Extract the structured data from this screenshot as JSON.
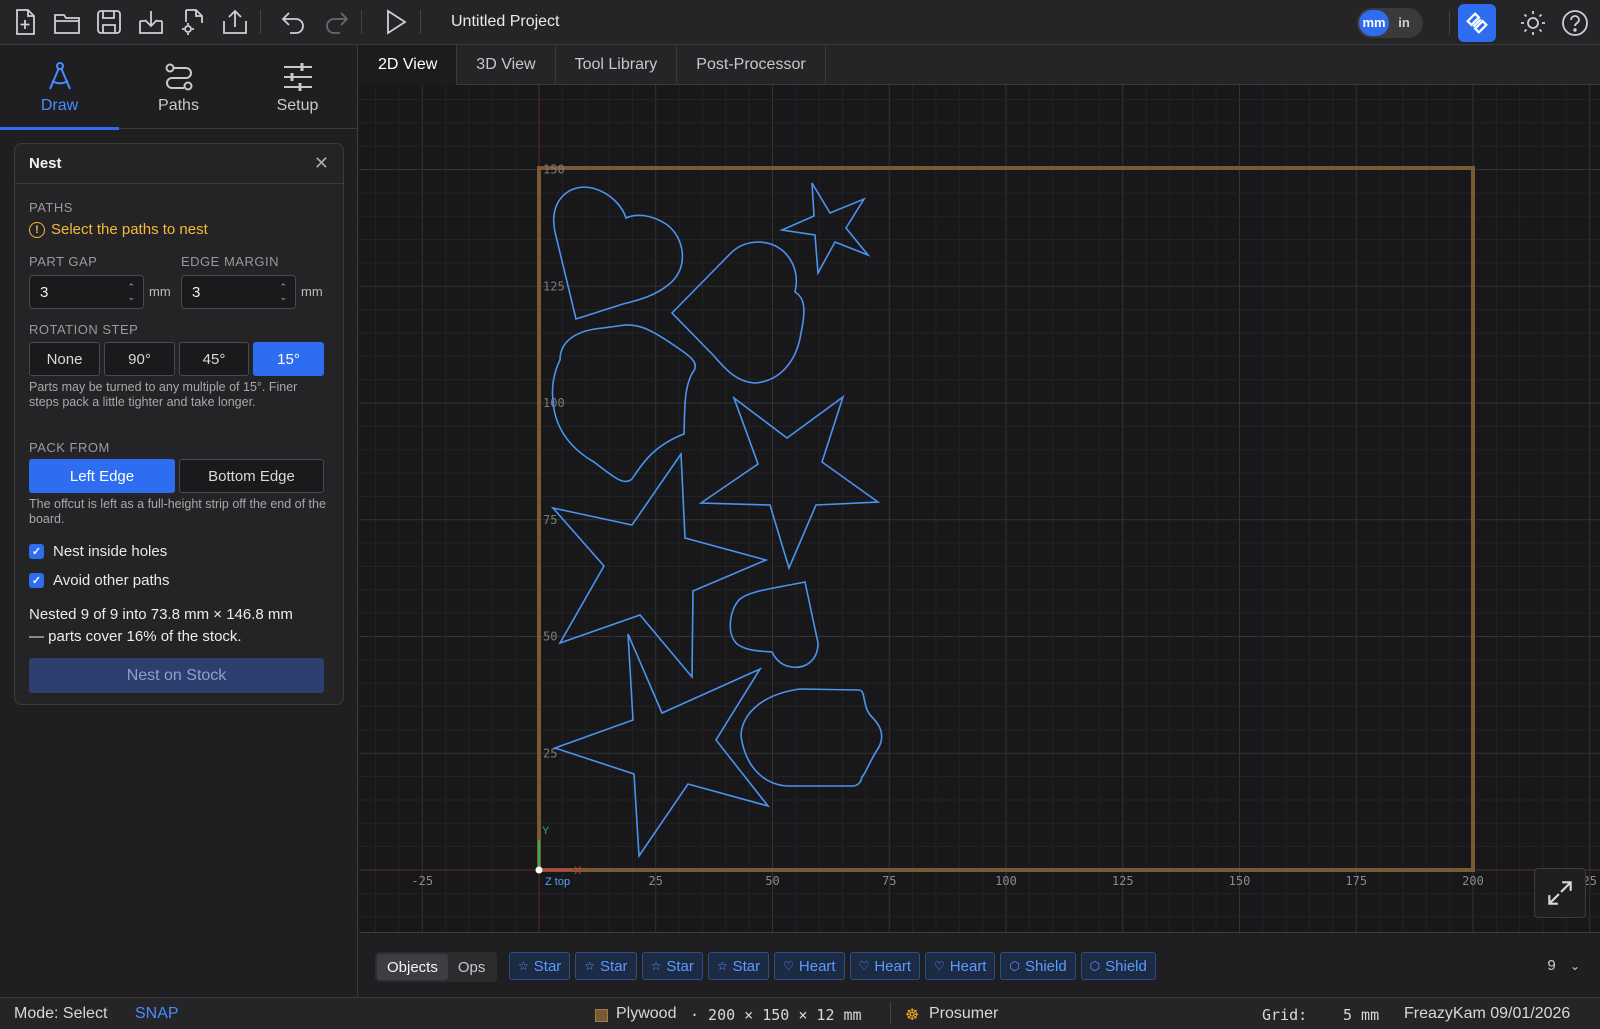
{
  "topbar": {
    "project_title": "Untitled Project",
    "units": {
      "mm": "mm",
      "in": "in",
      "active": "mm"
    },
    "icons": [
      "new-file-icon",
      "open-folder-icon",
      "save-icon",
      "download-icon",
      "file-settings-icon",
      "export-icon",
      "undo-icon",
      "redo-icon",
      "run-icon",
      "logo-icon",
      "theme-icon",
      "help-icon"
    ]
  },
  "mode_tabs": [
    {
      "label": "Draw",
      "icon": "compass-icon",
      "active": true
    },
    {
      "label": "Paths",
      "icon": "paths-icon",
      "active": false
    },
    {
      "label": "Setup",
      "icon": "sliders-icon",
      "active": false
    }
  ],
  "nest": {
    "title": "Nest",
    "paths_label": "PATHS",
    "warning": "Select the paths to nest",
    "part_gap_label": "PART GAP",
    "part_gap_value": "3",
    "edge_margin_label": "EDGE MARGIN",
    "edge_margin_value": "3",
    "unit": "mm",
    "rotation_label": "ROTATION STEP",
    "rotation_options": [
      "None",
      "90°",
      "45°",
      "15°"
    ],
    "rotation_selected": "15°",
    "rotation_hint": "Parts may be turned to any multiple of 15°. Finer steps pack a little tighter and take longer.",
    "pack_label": "PACK FROM",
    "pack_options": [
      "Left Edge",
      "Bottom Edge"
    ],
    "pack_selected": "Left Edge",
    "pack_hint": "The offcut is left as a full-height strip off the end of the board.",
    "nest_holes_label": "Nest inside holes",
    "nest_holes_checked": true,
    "avoid_label": "Avoid other paths",
    "avoid_checked": true,
    "result_line1": "Nested 9 of 9 into 73.8 mm × 146.8 mm",
    "result_line2": "— parts cover 16% of the stock.",
    "nest_button": "Nest on Stock"
  },
  "view_tabs": [
    {
      "label": "2D View",
      "active": true
    },
    {
      "label": "3D View",
      "active": false
    },
    {
      "label": "Tool Library",
      "active": false
    },
    {
      "label": "Post-Processor",
      "active": false
    }
  ],
  "canvas": {
    "stock_width": 200,
    "stock_height": 150,
    "x_ticks": [
      "-25",
      "25",
      "50",
      "75",
      "100",
      "125",
      "150",
      "175",
      "200",
      "25"
    ],
    "y_ticks": [
      "150",
      "125",
      "100",
      "75",
      "50",
      "25"
    ],
    "axis_y": "Y",
    "axis_x": "X",
    "axis_z": "Z top",
    "colors": {
      "stock": "#7a5a35",
      "path": "#4a94f0",
      "grid": "#2c2c2f",
      "x_axis": "#c84040",
      "y_axis": "#30b050"
    }
  },
  "objects_bar": {
    "toggle": [
      "Objects",
      "Ops"
    ],
    "active": "Objects",
    "chips": [
      {
        "label": "Star",
        "icon": "star-icon"
      },
      {
        "label": "Star",
        "icon": "star-icon"
      },
      {
        "label": "Star",
        "icon": "star-icon"
      },
      {
        "label": "Star",
        "icon": "star-icon"
      },
      {
        "label": "Heart",
        "icon": "heart-icon"
      },
      {
        "label": "Heart",
        "icon": "heart-icon"
      },
      {
        "label": "Heart",
        "icon": "heart-icon"
      },
      {
        "label": "Shield",
        "icon": "shield-icon"
      },
      {
        "label": "Shield",
        "icon": "shield-icon"
      }
    ],
    "count": "9"
  },
  "status": {
    "mode": "Mode: Select",
    "snap": "SNAP",
    "material": "Plywood",
    "dims": "· 200 × 150 × 12 mm",
    "machine": "Prosumer",
    "grid_label": "Grid:",
    "grid_value": "5 mm",
    "credit": "FreazyKam 09/01/2026"
  }
}
